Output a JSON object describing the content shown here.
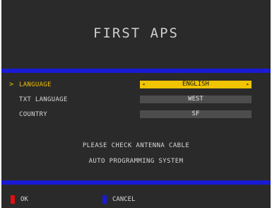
{
  "title": "FIRST APS",
  "menu": [
    {
      "label": "LANGUAGE",
      "value": "ENGLISH",
      "selected": true
    },
    {
      "label": "TXT LANGUAGE",
      "value": "WEST",
      "selected": false
    },
    {
      "label": "COUNTRY",
      "value": "SF",
      "selected": false
    }
  ],
  "cursor_glyph": ">",
  "arrows": {
    "left": "◂",
    "right": "▸"
  },
  "messages": {
    "line1": "PLEASE CHECK ANTENNA CABLE",
    "line2": "AUTO PROGRAMMING SYSTEM"
  },
  "legend": {
    "ok_label": "OK",
    "ok_color": "#e01010",
    "cancel_label": "CANCEL",
    "cancel_color": "#1a1ad6"
  },
  "colors": {
    "background": "#2a2a2a",
    "highlight": "#f0c400",
    "accent_bar": "#1a1ad6"
  }
}
